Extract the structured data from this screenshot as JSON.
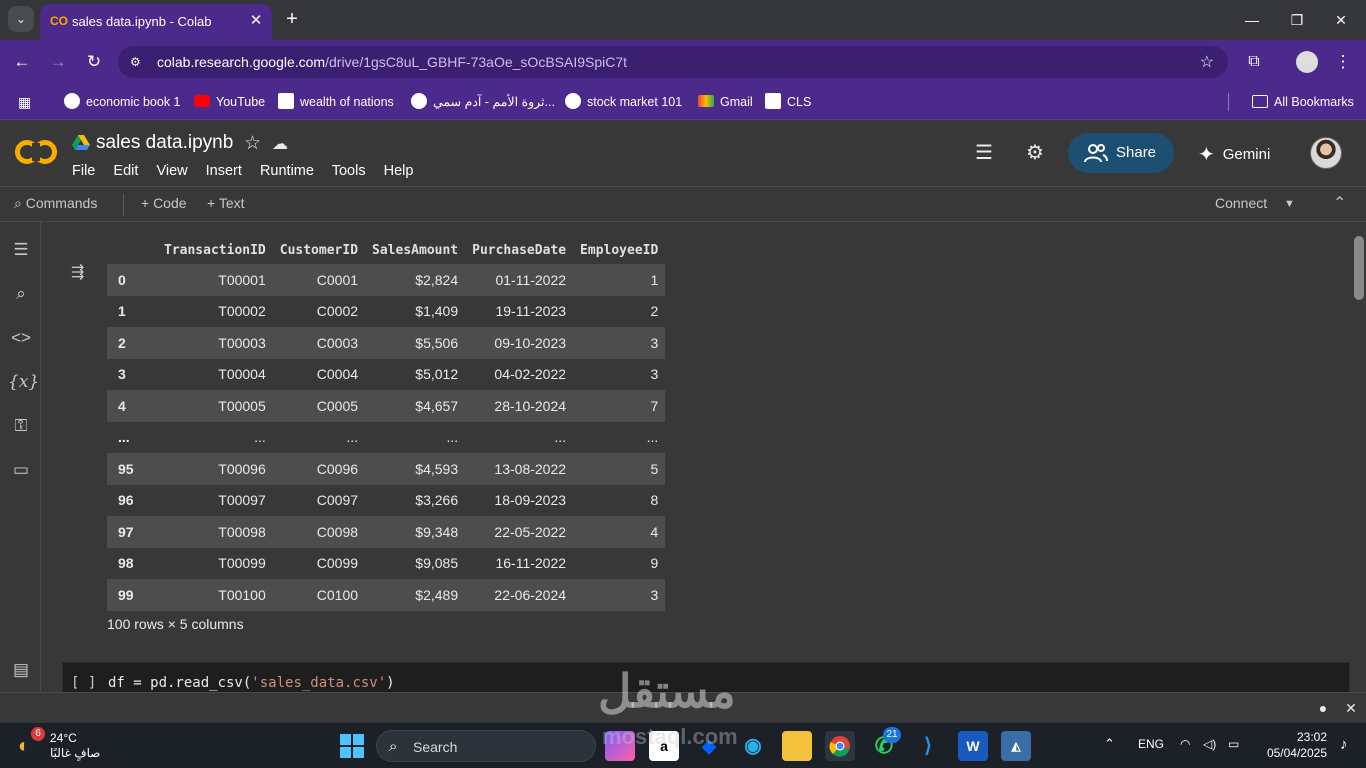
{
  "browser": {
    "tab_title": "sales data.ipynb - Colab",
    "url_host": "colab.research.google.com",
    "url_path": "/drive/1gsC8uL_GBHF-73aOe_sOcBSAI9SpiC7t",
    "bookmarks": [
      "economic book 1",
      "YouTube",
      "wealth of nations",
      "ثروة الأمم - آدم سمي...",
      "stock market 101",
      "Gmail",
      "CLS"
    ],
    "all_bookmarks": "All Bookmarks"
  },
  "colab": {
    "notebook_title": "sales data.ipynb",
    "menu": [
      "File",
      "Edit",
      "View",
      "Insert",
      "Runtime",
      "Tools",
      "Help"
    ],
    "share_label": "Share",
    "gemini_label": "Gemini",
    "toolbar": {
      "commands": "Commands",
      "code": "+ Code",
      "text": "+ Text",
      "connect": "Connect"
    }
  },
  "dataframe": {
    "columns": [
      "TransactionID",
      "CustomerID",
      "SalesAmount",
      "PurchaseDate",
      "EmployeeID"
    ],
    "rows": [
      [
        "0",
        "T00001",
        "C0001",
        "$2,824",
        "01-11-2022",
        "1"
      ],
      [
        "1",
        "T00002",
        "C0002",
        "$1,409",
        "19-11-2023",
        "2"
      ],
      [
        "2",
        "T00003",
        "C0003",
        "$5,506",
        "09-10-2023",
        "3"
      ],
      [
        "3",
        "T00004",
        "C0004",
        "$5,012",
        "04-02-2022",
        "3"
      ],
      [
        "4",
        "T00005",
        "C0005",
        "$4,657",
        "28-10-2024",
        "7"
      ],
      [
        "...",
        "...",
        "...",
        "...",
        "...",
        "..."
      ],
      [
        "95",
        "T00096",
        "C0096",
        "$4,593",
        "13-08-2022",
        "5"
      ],
      [
        "96",
        "T00097",
        "C0097",
        "$3,266",
        "18-09-2023",
        "8"
      ],
      [
        "97",
        "T00098",
        "C0098",
        "$9,348",
        "22-05-2022",
        "4"
      ],
      [
        "98",
        "T00099",
        "C0099",
        "$9,085",
        "16-11-2022",
        "9"
      ],
      [
        "99",
        "T00100",
        "C0100",
        "$2,489",
        "22-06-2024",
        "3"
      ]
    ],
    "shape_text": "100 rows × 5 columns"
  },
  "next_cell": {
    "bracket": "[ ]",
    "code_prefix": "df = pd.read_csv(",
    "code_string": "'sales_data.csv'",
    "code_suffix": ")"
  },
  "taskbar": {
    "weather_badge": "6",
    "temperature": "24°C",
    "weather_desc": "صافٍ غالبًا",
    "search_label": "Search",
    "whatsapp_badge": "21",
    "language": "ENG",
    "time": "23:02",
    "date": "05/04/2025"
  },
  "watermark": {
    "arabic": "مستقل",
    "latin": "mostaql.com"
  }
}
